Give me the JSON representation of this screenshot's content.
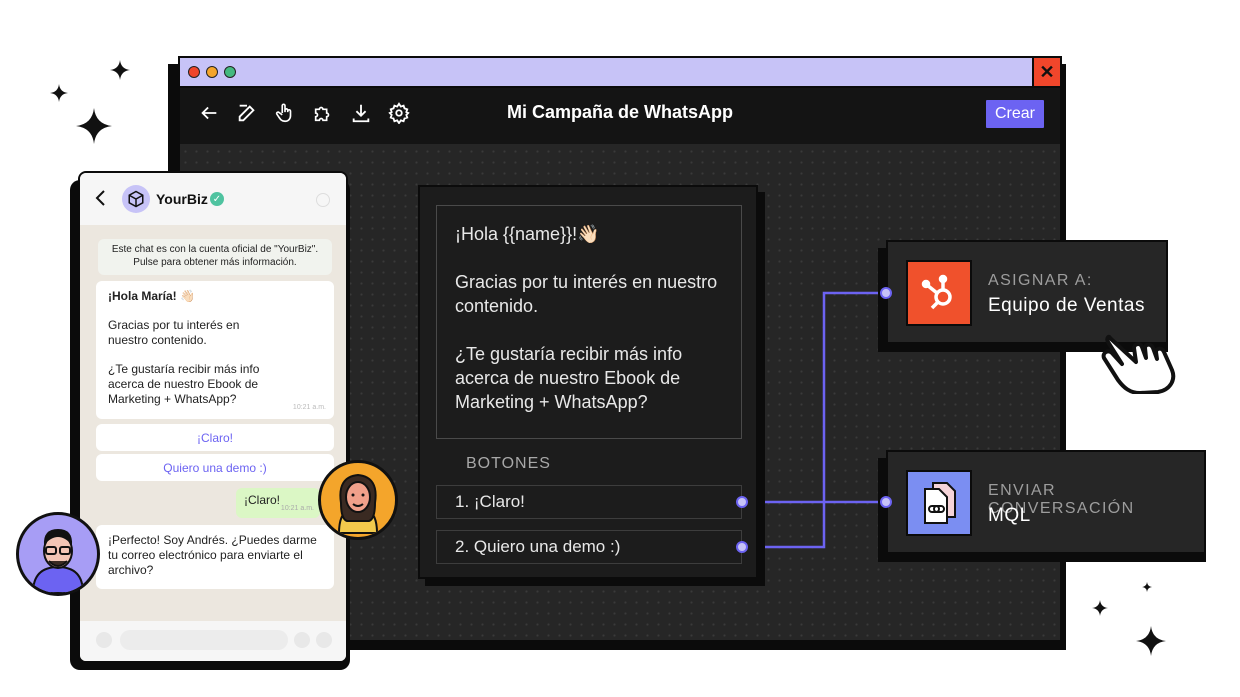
{
  "window": {
    "title": "Mi Campaña de WhatsApp",
    "create_label": "Crear",
    "close_symbol": "✕",
    "toolbar_icons": [
      "back-arrow-icon",
      "edit-icon",
      "hand-pointer-icon",
      "puzzle-icon",
      "download-icon",
      "settings-icon"
    ]
  },
  "message_node": {
    "greeting": "¡Hola {{name}}!👋🏻",
    "line2": "Gracias por tu interés en nuestro contenido.",
    "line3": "¿Te gustaría recibir más info acerca de nuestro Ebook de Marketing + WhatsApp?",
    "buttons_label": "BOTONES",
    "buttons": [
      "1. ¡Claro!",
      "2. Quiero una demo :)"
    ]
  },
  "actions": [
    {
      "label": "ASIGNAR A:",
      "value": "Equipo de Ventas",
      "icon": "hubspot-icon",
      "color": "#f0512c"
    },
    {
      "label": "ENVIAR CONVERSACIÓN",
      "value": "MQL",
      "icon": "documents-link-icon",
      "color": "#7b8ef2"
    }
  ],
  "phone": {
    "contact_name": "YourBiz",
    "system_notice": "Este chat es con la cuenta oficial de \"YourBiz\". Pulse para obtener más información.",
    "incoming_greeting": "¡Hola María! 👋🏻",
    "incoming_line2": "Gracias por tu interés en nuestro contenido.",
    "incoming_line3": "¿Te gustaría recibir más info acerca de nuestro Ebook de Marketing + WhatsApp?",
    "incoming_time": "10:21 a.m.",
    "quick_replies": [
      "¡Claro!",
      "Quiero una demo :)"
    ],
    "outgoing": "¡Claro!",
    "outgoing_time": "10:21 a.m.",
    "reply": "¡Perfecto! Soy Andrés. ¿Puedes darme tu correo electrónico para enviarte el archivo?"
  },
  "colors": {
    "accent": "#6c63f2",
    "titlebar": "#c7c3f7",
    "close": "#f0462b",
    "verified": "#4fc3a0"
  }
}
